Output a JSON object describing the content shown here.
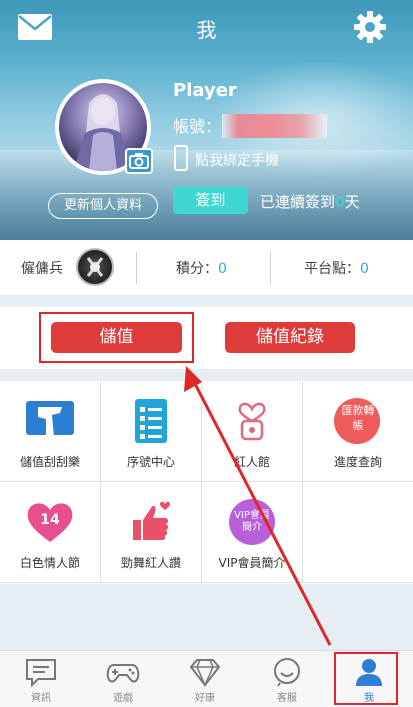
{
  "header": {
    "title": "我",
    "username": "Player",
    "account_label": "帳號：",
    "bind_phone": "點我綁定手機",
    "checkin_label": "簽到",
    "streak_prefix": "已連續簽到",
    "streak_days": "0",
    "streak_suffix": "天",
    "update_profile": "更新個人資料"
  },
  "stats": {
    "mercenary_label": "僱傭兵",
    "points_label": "積分：",
    "points_value": "0",
    "platform_label": "平台點：",
    "platform_value": "0"
  },
  "actions": {
    "topup": "儲值",
    "topup_history": "儲值紀錄"
  },
  "grid": {
    "items": [
      {
        "label": "儲值刮刮樂",
        "icon": "scratch-card-icon"
      },
      {
        "label": "序號中心",
        "icon": "serial-list-icon"
      },
      {
        "label": "紅人館",
        "icon": "heart-lock-icon"
      },
      {
        "label": "進度查詢",
        "icon": "remittance-icon",
        "icon_text": "匯款轉帳"
      },
      {
        "label": "白色情人節",
        "icon": "heart-14-icon",
        "icon_text": "14"
      },
      {
        "label": "勁舞紅人讚",
        "icon": "thumbs-up-heart-icon"
      },
      {
        "label": "VIP會員簡介",
        "icon": "vip-icon",
        "icon_text": "VIP會員簡介"
      }
    ]
  },
  "tabbar": {
    "items": [
      {
        "label": "資訊",
        "icon": "chat-icon"
      },
      {
        "label": "遊戲",
        "icon": "gamepad-icon"
      },
      {
        "label": "好康",
        "icon": "diamond-icon"
      },
      {
        "label": "客服",
        "icon": "smile-icon"
      },
      {
        "label": "我",
        "icon": "person-icon",
        "active": true
      }
    ]
  },
  "colors": {
    "accent_red": "#de3b3b",
    "accent_cyan": "#3fd7d2",
    "accent_blue": "#2d7fd6",
    "annotation_red": "#e02727"
  }
}
